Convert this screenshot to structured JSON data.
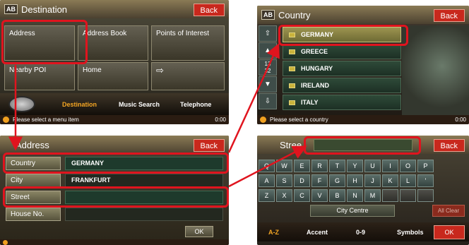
{
  "screen1": {
    "title_icon": "AB",
    "title": "Destination",
    "back": "Back",
    "tiles": [
      "Address",
      "Address Book",
      "Points of Interest",
      "Nearby POI",
      "Home"
    ],
    "menu": [
      "Destination",
      "Music Search",
      "Telephone"
    ],
    "status": "Please select a menu item",
    "clock": "0:00"
  },
  "screen2": {
    "title_icon": "AB",
    "title": "Country",
    "back": "Back",
    "scroll_labels": [
      "13",
      "32"
    ],
    "countries": [
      "GERMANY",
      "GREECE",
      "HUNGARY",
      "IRELAND",
      "ITALY"
    ],
    "selected": "GERMANY",
    "status": "Please select a country",
    "clock": "0:00"
  },
  "screen3": {
    "title": "Address",
    "back": "Back",
    "fields": [
      {
        "label": "Country",
        "value": "GERMANY"
      },
      {
        "label": "City",
        "value": "FRANKFURT"
      },
      {
        "label": "Street",
        "value": ""
      },
      {
        "label": "House No.",
        "value": ""
      }
    ],
    "ok": "OK"
  },
  "screen4": {
    "field_label": "Stree",
    "back": "Back",
    "keys_row1": [
      "Q",
      "W",
      "E",
      "R",
      "T",
      "Y",
      "U",
      "I",
      "O",
      "P"
    ],
    "keys_row2": [
      "A",
      "S",
      "D",
      "F",
      "G",
      "H",
      "J",
      "K",
      "L",
      "'"
    ],
    "keys_row3": [
      "Z",
      "X",
      "C",
      "V",
      "B",
      "N",
      "M",
      "",
      "",
      ""
    ],
    "city_centre": "City Centre",
    "all_clear": "All Clear",
    "bottom": [
      "A-Z",
      "Accent",
      "0-9",
      "Symbols"
    ],
    "ok": "OK"
  },
  "colors": {
    "highlight": "#e0141e",
    "back_button": "#c8281d",
    "menu_active": "#f5a623"
  }
}
